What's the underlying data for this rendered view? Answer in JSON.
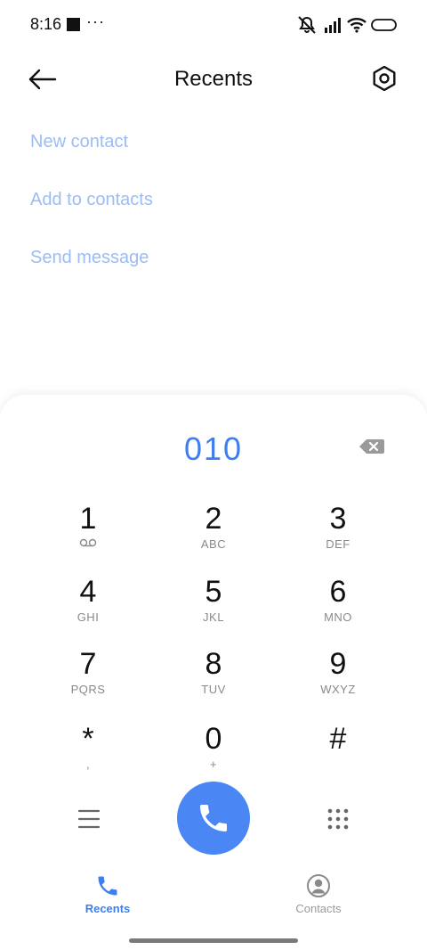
{
  "status_bar": {
    "time": "8:16",
    "dots": "···",
    "icons": [
      "notifications-off-icon",
      "signal-icon",
      "wifi-icon",
      "battery-icon"
    ]
  },
  "header": {
    "title": "Recents",
    "back_icon": "back-arrow-icon",
    "settings_icon": "settings-icon"
  },
  "actions": {
    "new_contact": "New contact",
    "add_to_contacts": "Add to contacts",
    "send_message": "Send message"
  },
  "dialer": {
    "number": "010",
    "keys": [
      {
        "digit": "1",
        "letters": ""
      },
      {
        "digit": "2",
        "letters": "ABC"
      },
      {
        "digit": "3",
        "letters": "DEF"
      },
      {
        "digit": "4",
        "letters": "GHI"
      },
      {
        "digit": "5",
        "letters": "JKL"
      },
      {
        "digit": "6",
        "letters": "MNO"
      },
      {
        "digit": "7",
        "letters": "PQRS"
      },
      {
        "digit": "8",
        "letters": "TUV"
      },
      {
        "digit": "9",
        "letters": "WXYZ"
      },
      {
        "digit": "*",
        "letters": ","
      },
      {
        "digit": "0",
        "letters": "+"
      },
      {
        "digit": "#",
        "letters": ""
      }
    ]
  },
  "bottom_nav": {
    "tabs": [
      {
        "label": "Recents",
        "icon": "phone-icon",
        "active": true
      },
      {
        "label": "Contacts",
        "icon": "person-icon",
        "active": false
      }
    ]
  },
  "colors": {
    "accent": "#3d7ff0",
    "call_button": "#4a86f4",
    "link": "#9bbcf4"
  }
}
